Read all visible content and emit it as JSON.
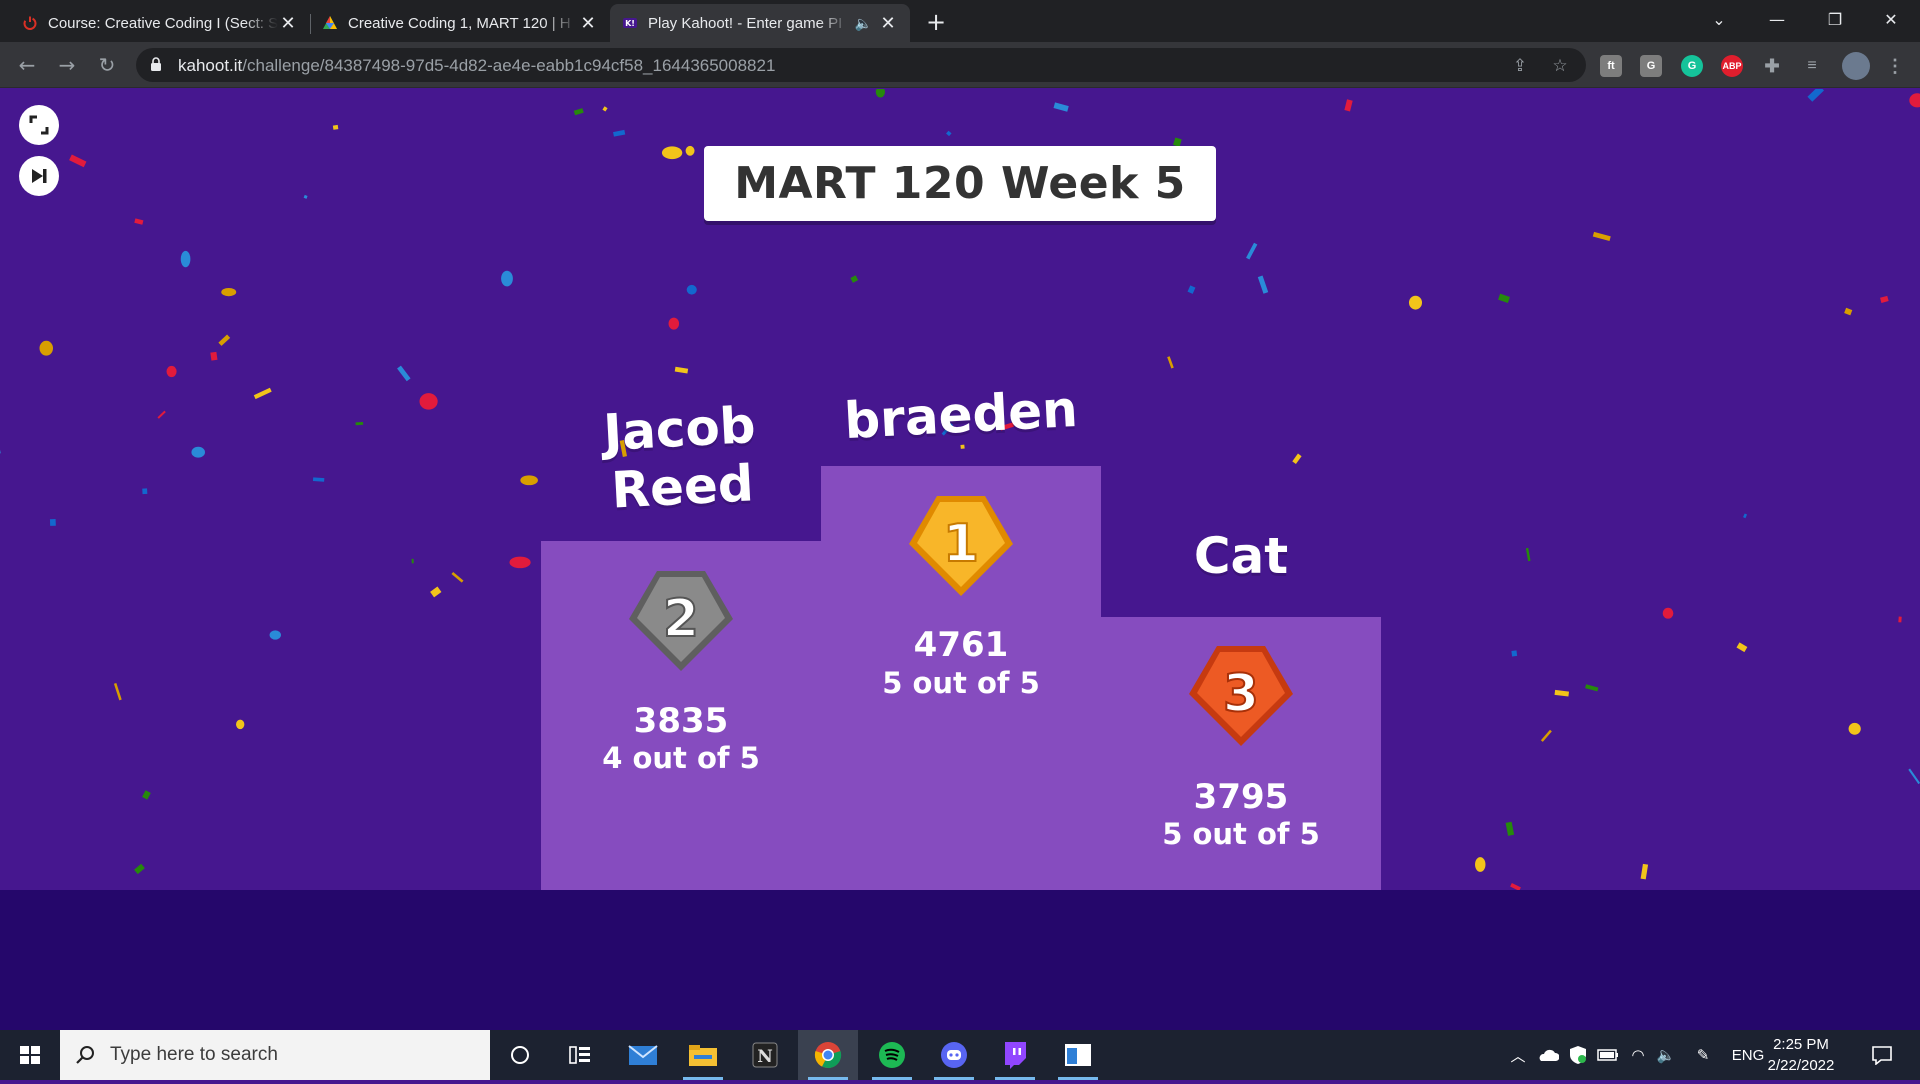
{
  "browser": {
    "tabs": [
      {
        "title": "Course: Creative Coding I (Sect: S",
        "active": false
      },
      {
        "title": "Creative Coding 1, MART 120 | H",
        "active": false
      },
      {
        "title": "Play Kahoot! - Enter game PI",
        "active": true,
        "audio": true
      }
    ],
    "url_host": "kahoot.it",
    "url_path": "/challenge/84387498-97d5-4d82-ae4e-eabb1c94cf58_1644365008821",
    "extensions": [
      "fab-icon",
      "g-extension-icon",
      "grammarly-icon",
      "adblock-plus-icon",
      "extensions-puzzle-icon",
      "reading-list-icon",
      "profile-avatar"
    ]
  },
  "game": {
    "title": "MART 120 Week 5",
    "podium": [
      {
        "place": "2",
        "name_lines": [
          "Jacob",
          "Reed"
        ],
        "score": "3835",
        "correct": "4 out of 5",
        "medal_color": "#8a8a8a"
      },
      {
        "place": "1",
        "name_lines": [
          "braeden"
        ],
        "score": "4761",
        "correct": "5 out of 5",
        "medal_color": "#f5a623"
      },
      {
        "place": "3",
        "name_lines": [
          "Cat"
        ],
        "score": "3795",
        "correct": "5 out of 5",
        "medal_color": "#e8471b"
      }
    ]
  },
  "taskbar": {
    "search_placeholder": "Type here to search",
    "language": "ENG",
    "time": "2:25 PM",
    "date": "2/22/2022"
  },
  "colors": {
    "stage_bg": "#46178f",
    "footer_bg": "#25076b",
    "podium_bg": "#864cbf"
  }
}
